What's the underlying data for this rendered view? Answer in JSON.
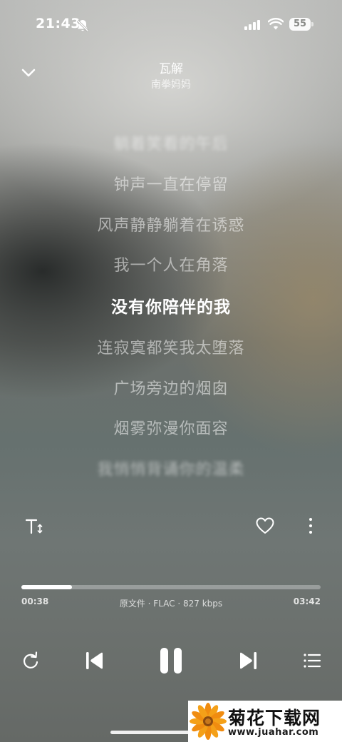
{
  "status_bar": {
    "time": "21:43",
    "battery": "55"
  },
  "header": {
    "title": "瓦解",
    "artist": "南拳妈妈"
  },
  "lyrics": [
    "躺着笑看的午后",
    "钟声一直在停留",
    "风声静静躺着在诱惑",
    "我一个人在角落",
    "没有你陪伴的我",
    "连寂寞都笑我太堕落",
    "广场旁边的烟囱",
    "烟雾弥漫你面容",
    "我悄悄背诵你的温柔"
  ],
  "current_lyric_index": 4,
  "playback": {
    "elapsed": "00:38",
    "total": "03:42",
    "quality": "原文件 · FLAC · 827 kbps",
    "progress_fraction": 0.17
  },
  "icons": {
    "collapse": "chevron-down-icon",
    "lyric_size": "text-size-icon",
    "favorite": "heart-icon",
    "more": "more-vertical-icon",
    "repeat": "repeat-icon",
    "previous": "skip-previous-icon",
    "play_pause": "pause-icon",
    "next": "skip-next-icon",
    "playlist": "playlist-icon"
  },
  "watermark": {
    "title": "菊花下载网",
    "url": "www.juahar.com"
  }
}
